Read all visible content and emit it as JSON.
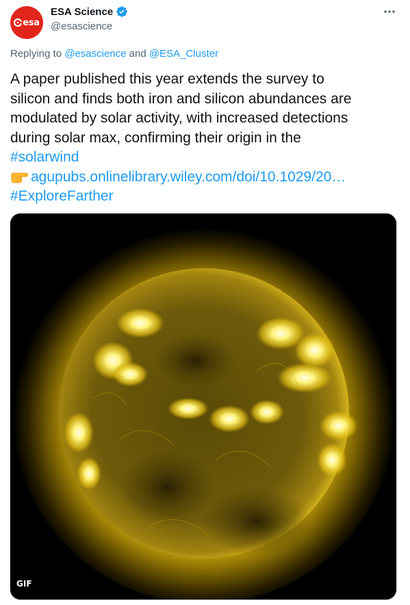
{
  "account": {
    "display_name": "ESA Science",
    "handle": "@esascience",
    "avatar_text": "esa",
    "verified": true
  },
  "reply": {
    "prefix": "Replying to ",
    "mention_1": "@esascience",
    "joiner": " and ",
    "mention_2": "@ESA_Cluster"
  },
  "tweet": {
    "line_1": "A paper published this year extends the survey to",
    "line_2": "silicon and finds both iron and silicon abundances are",
    "line_3": "modulated by solar activity, with increased detections",
    "line_4": "during solar max, confirming their origin in the",
    "hashtag_1": "#solarwind",
    "link": "agupubs.onlinelibrary.wiley.com/doi/10.1029/20…",
    "hashtag_2": "#ExploreFarther"
  },
  "media": {
    "badge": "GIF"
  },
  "colors": {
    "link": "#1d9bf0",
    "secondary_text": "#536471",
    "avatar_bg": "#e1251b",
    "verified": "#1d9bf0"
  },
  "icons": {
    "verified": "verified-badge-icon",
    "more": "more-dots-icon",
    "pointing": "pointing-right-emoji"
  }
}
